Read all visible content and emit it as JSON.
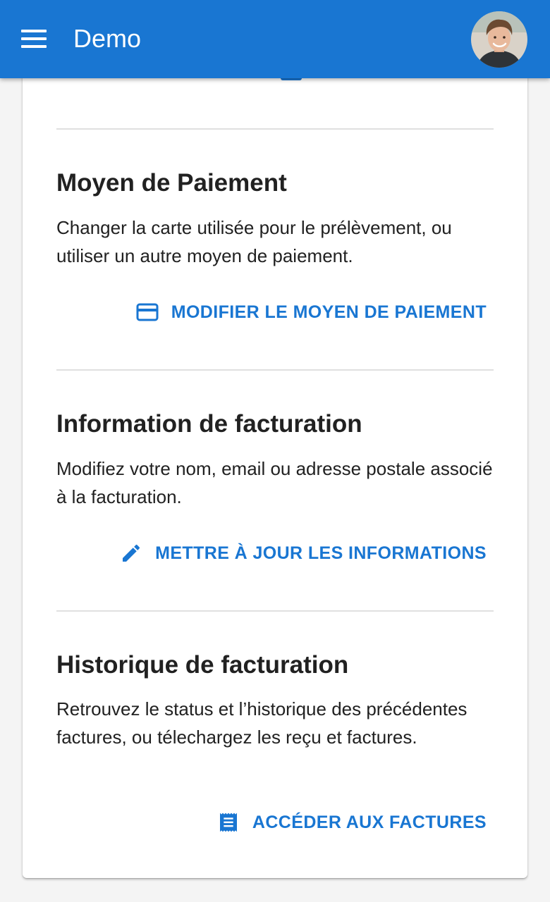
{
  "appbar": {
    "title": "Demo",
    "menu_icon": "hamburger-menu-icon",
    "avatar": "user-avatar"
  },
  "sections": [
    {
      "title": "Moyen de Paiement",
      "description": "Changer la carte utilisée pour le prélèvement, ou utiliser un autre moyen de paiement.",
      "action_label": "MODIFIER LE MOYEN DE PAIEMENT",
      "action_icon": "credit-card-icon"
    },
    {
      "title": "Information de facturation",
      "description": "Modifiez votre nom, email ou adresse postale associé à la facturation.",
      "action_label": "METTRE À JOUR LES INFORMATIONS",
      "action_icon": "pencil-icon"
    },
    {
      "title": "Historique de facturation",
      "description": "Retrouvez le status et l’historique des précédentes factures, ou télechargez les reçu et factures.",
      "action_label": "ACCÉDER AUX FACTURES",
      "action_icon": "receipt-icon"
    }
  ],
  "colors": {
    "primary": "#1976d2",
    "background": "#f4f4f4",
    "text": "#212121",
    "divider": "#e0e0e0"
  }
}
